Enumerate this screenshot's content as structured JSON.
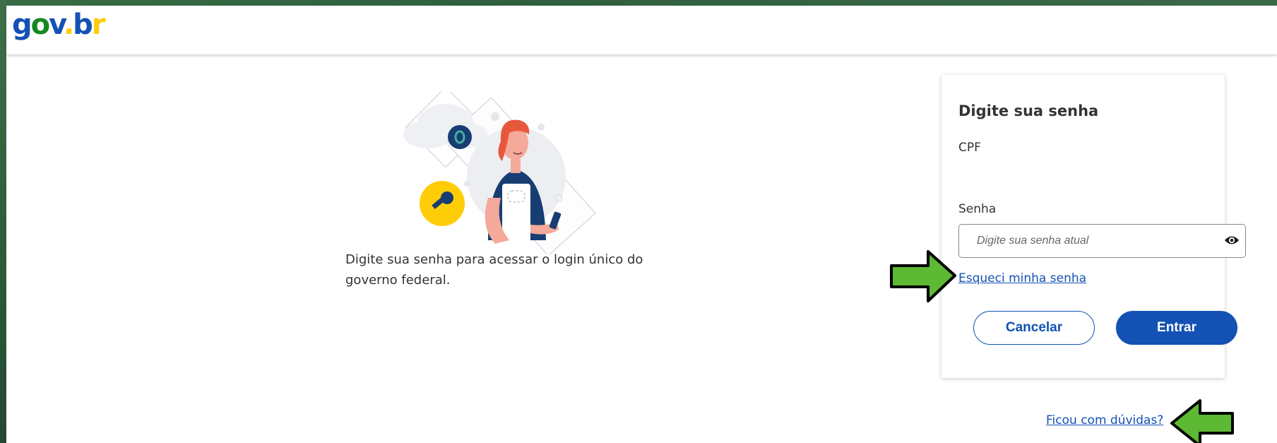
{
  "header": {
    "logo_text": "gov.br"
  },
  "intro": {
    "illustration": "person-with-phone-and-key-illustration",
    "text": "Digite sua senha para acessar o login único do governo federal."
  },
  "login_card": {
    "title": "Digite sua senha",
    "cpf_label": "CPF",
    "password_label": "Senha",
    "password_placeholder": "Digite sua senha atual",
    "password_value": "",
    "show_password_icon": "eye-icon",
    "forgot_link": "Esqueci minha senha",
    "cancel_button": "Cancelar",
    "enter_button": "Entrar"
  },
  "help_link": "Ficou com dúvidas?",
  "annotations": {
    "arrow_color": "#5db833",
    "arrow_outline": "#000000"
  },
  "colors": {
    "primary": "#1351b4",
    "brand_yellow": "#ffcd07",
    "brand_green": "#168821",
    "frame_green": "#2d5a3a"
  }
}
